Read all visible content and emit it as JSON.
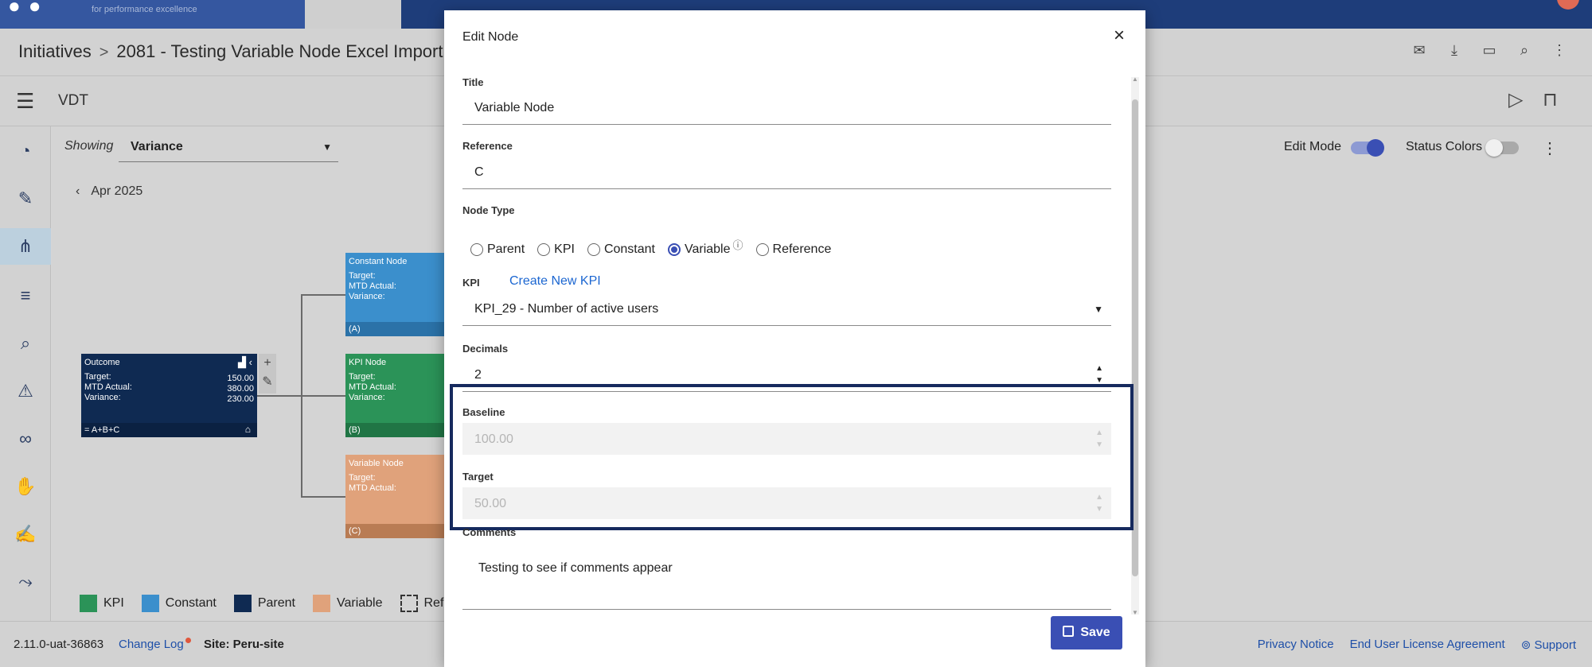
{
  "topbar": {
    "logo_tagline": "for performance excellence"
  },
  "breadcrumb": {
    "root": "Initiatives",
    "separator": ">",
    "current": "2081 - Testing Variable Node Excel Import"
  },
  "app": {
    "name": "VDT"
  },
  "view": {
    "showing_label": "Showing",
    "showing_value": "Variance",
    "month": "Apr 2025",
    "edit_mode_label": "Edit Mode",
    "edit_mode_on": true,
    "status_colors_label": "Status Colors",
    "status_colors_on": false
  },
  "tree": {
    "outcome": {
      "title": "Outcome",
      "labels": [
        "Target:",
        "MTD Actual:",
        "Variance:"
      ],
      "values": [
        "150.00",
        "380.00",
        "230.00"
      ],
      "formula": "= A+B+C"
    },
    "constant": {
      "title": "Constant Node",
      "labels": [
        "Target:",
        "MTD Actual:",
        "Variance:"
      ],
      "ref": "(A)"
    },
    "kpi": {
      "title": "KPI Node",
      "labels": [
        "Target:",
        "MTD Actual:",
        "Variance:"
      ],
      "ref": "(B)"
    },
    "variable": {
      "title": "Variable Node",
      "labels": [
        "Target:",
        "MTD Actual:"
      ],
      "ref": "(C)"
    }
  },
  "legend": [
    {
      "label": "KPI",
      "color": "#2b9358"
    },
    {
      "label": "Constant",
      "color": "#3b8fcc"
    },
    {
      "label": "Parent",
      "color": "#0f2a52"
    },
    {
      "label": "Variable",
      "color": "#e0a27b"
    },
    {
      "label": "Referen",
      "color": ""
    }
  ],
  "footer": {
    "version": "2.11.0-uat-36863",
    "change_log": "Change Log",
    "site": "Site: Peru-site",
    "privacy": "Privacy Notice",
    "eula": "End User License Agreement",
    "support": "Support"
  },
  "modal": {
    "title": "Edit Node",
    "close": "×",
    "fields": {
      "title_label": "Title",
      "title_value": "Variable Node",
      "reference_label": "Reference",
      "reference_value": "C",
      "node_type_label": "Node Type",
      "node_types": [
        "Parent",
        "KPI",
        "Constant",
        "Variable",
        "Reference"
      ],
      "node_type_selected": "Variable",
      "kpi_label": "KPI",
      "create_kpi": "Create New KPI",
      "kpi_value": "KPI_29 - Number of active users",
      "decimals_label": "Decimals",
      "decimals_value": "2",
      "baseline_label": "Baseline",
      "baseline_value": "100.00",
      "target_label": "Target",
      "target_value": "50.00",
      "comments_label": "Comments",
      "comments_value": "Testing to see if comments appear"
    },
    "save": "Save"
  },
  "colors": {
    "accent": "#3a4fb4",
    "highlight_border": "#162a5e",
    "link": "#1b66d1"
  }
}
